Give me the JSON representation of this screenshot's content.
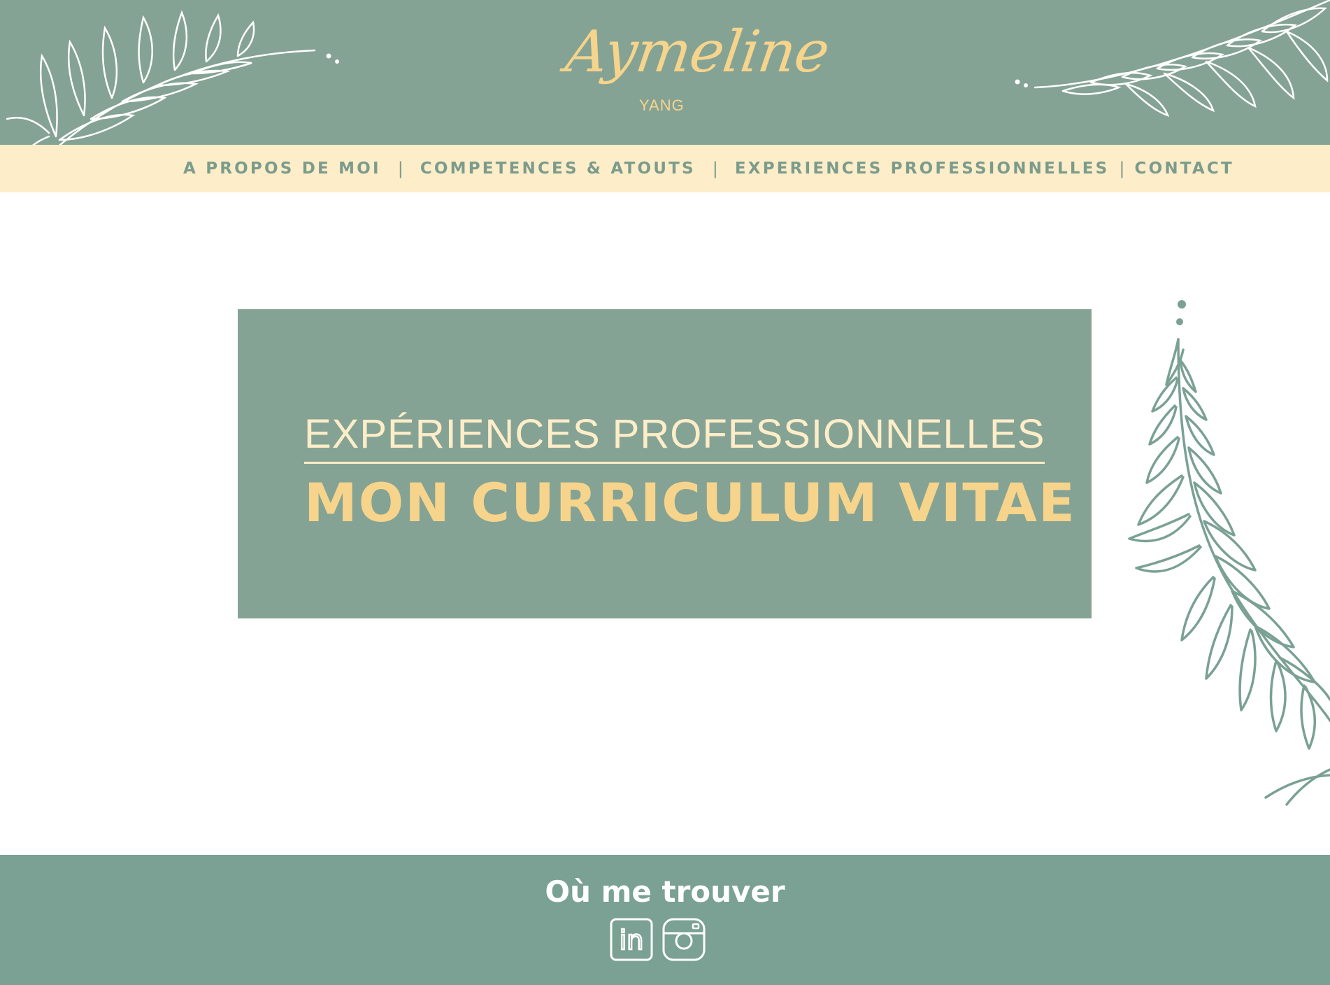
{
  "brand": {
    "name": "Aymeline",
    "surname": "YANG"
  },
  "nav": {
    "items": [
      "A PROPOS DE MOI",
      "COMPETENCES & ATOUTS",
      "EXPERIENCES PROFESSIONNELLES",
      "CONTACT"
    ],
    "separator": "|"
  },
  "hero": {
    "subtitle": "EXPÉRIENCES PROFESSIONNELLES",
    "title": "MON CURRICULUM VITAE"
  },
  "footer": {
    "title": "Où me trouver",
    "social": [
      {
        "icon": "linkedin-icon",
        "label": "in"
      },
      {
        "icon": "instagram-icon"
      }
    ]
  },
  "colors": {
    "sage": "#85a394",
    "footer_sage": "#7aa193",
    "cream": "#fdedc8",
    "gold": "#f6d48c",
    "white": "#ffffff"
  }
}
